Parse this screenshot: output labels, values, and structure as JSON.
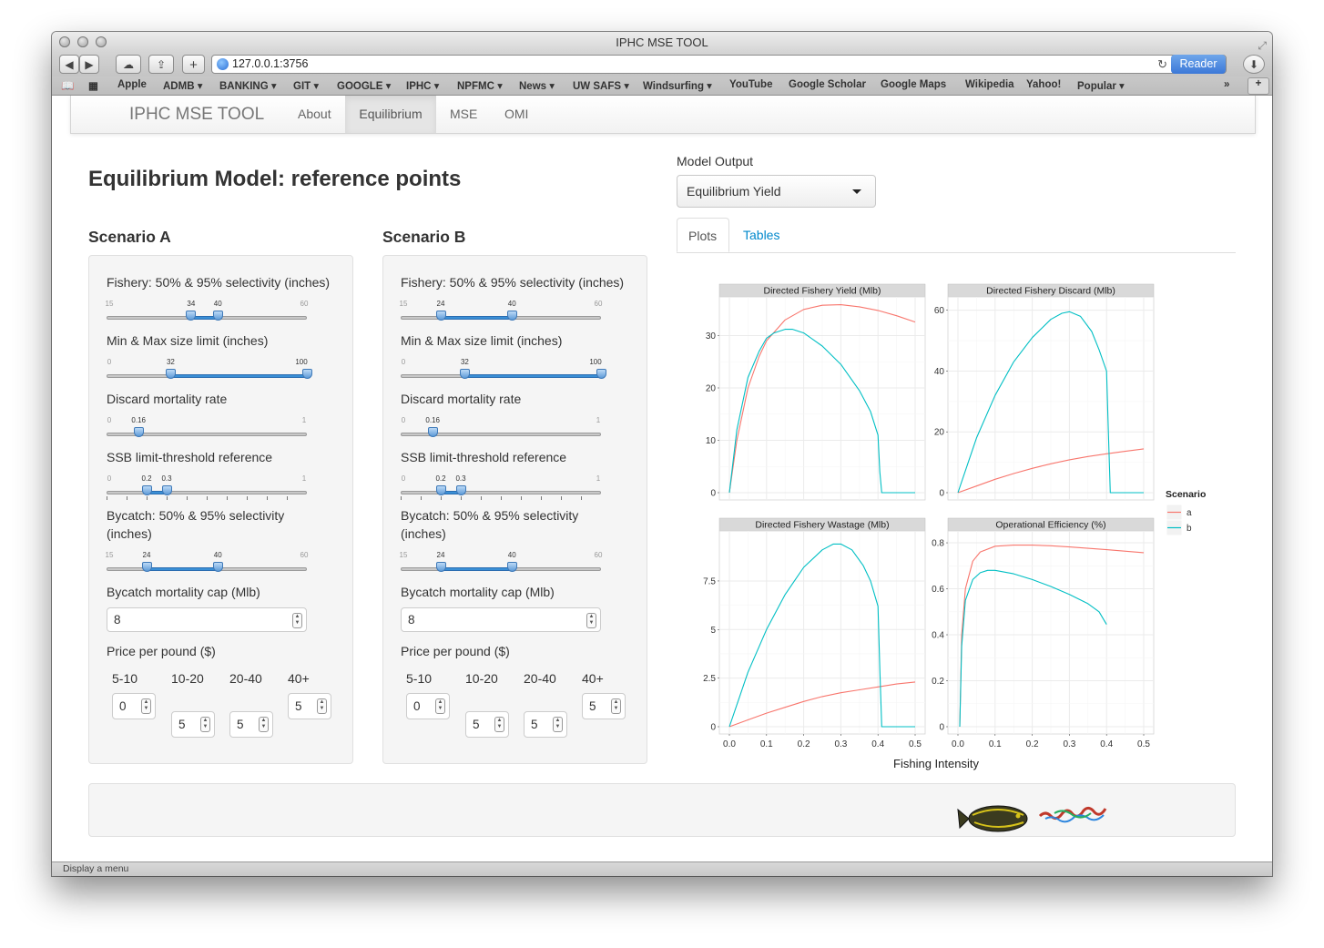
{
  "window": {
    "title": "IPHC MSE TOOL"
  },
  "browser": {
    "url": "127.0.0.1:3756",
    "reader_label": "Reader",
    "add_tab_label": "+",
    "bookmarks": [
      "Apple",
      "ADMB",
      "BANKING",
      "GIT",
      "GOOGLE",
      "IPHC",
      "NPFMC",
      "News",
      "UW SAFS",
      "Windsurfing",
      "YouTube",
      "Google Scholar",
      "Google Maps",
      "Wikipedia",
      "Yahoo!",
      "Popular"
    ],
    "bookmarks_with_menu": [
      "ADMB",
      "BANKING",
      "GIT",
      "GOOGLE",
      "IPHC",
      "NPFMC",
      "News",
      "UW SAFS",
      "Windsurfing",
      "Popular"
    ],
    "status_text": "Display a menu"
  },
  "navbar": {
    "brand": "IPHC MSE TOOL",
    "items": [
      {
        "label": "About",
        "active": false
      },
      {
        "label": "Equilibrium",
        "active": true
      },
      {
        "label": "MSE",
        "active": false
      },
      {
        "label": "OMI",
        "active": false
      }
    ]
  },
  "page_title": "Equilibrium Model: reference points",
  "scenarios": [
    {
      "title": "Scenario A",
      "fishery_selectivity": {
        "label": "Fishery: 50% & 95% selectivity (inches)",
        "min": 15,
        "max": 60,
        "values": [
          34,
          40
        ],
        "min_label": "15",
        "max_label": "60",
        "value_labels": [
          "34",
          "40"
        ]
      },
      "size_limit": {
        "label": "Min & Max size limit (inches)",
        "min": 0,
        "max": 100,
        "values": [
          32,
          100
        ],
        "min_label": "0",
        "value_labels": [
          "32",
          "100"
        ]
      },
      "discard_mortality": {
        "label": "Discard mortality rate",
        "min": 0,
        "max": 1,
        "value": 0.16,
        "min_label": "0",
        "max_label": "1",
        "value_label": "0.16"
      },
      "ssb_reference": {
        "label": "SSB limit-threshold reference",
        "min": 0,
        "max": 1,
        "values": [
          0.2,
          0.3
        ],
        "min_label": "0",
        "max_label": "1",
        "value_labels": [
          "0.2",
          "0.3"
        ]
      },
      "bycatch_selectivity": {
        "label": "Bycatch: 50% & 95% selectivity (inches)",
        "min": 15,
        "max": 60,
        "values": [
          24,
          40
        ],
        "min_label": "15",
        "max_label": "60",
        "value_labels": [
          "24",
          "40"
        ]
      },
      "bycatch_cap": {
        "label": "Bycatch mortality cap (Mlb)",
        "value": "8"
      },
      "price": {
        "label": "Price per pound ($)",
        "bins": [
          {
            "label": "5-10",
            "value": "0"
          },
          {
            "label": "10-20",
            "value": "5"
          },
          {
            "label": "20-40",
            "value": "5"
          },
          {
            "label": "40+",
            "value": "5"
          }
        ]
      }
    },
    {
      "title": "Scenario B",
      "fishery_selectivity": {
        "label": "Fishery: 50% & 95% selectivity (inches)",
        "min": 15,
        "max": 60,
        "values": [
          24,
          40
        ],
        "min_label": "15",
        "max_label": "60",
        "value_labels": [
          "24",
          "40"
        ]
      },
      "size_limit": {
        "label": "Min & Max size limit (inches)",
        "min": 0,
        "max": 100,
        "values": [
          32,
          100
        ],
        "min_label": "0",
        "value_labels": [
          "32",
          "100"
        ]
      },
      "discard_mortality": {
        "label": "Discard mortality rate",
        "min": 0,
        "max": 1,
        "value": 0.16,
        "min_label": "0",
        "max_label": "1",
        "value_label": "0.16"
      },
      "ssb_reference": {
        "label": "SSB limit-threshold reference",
        "min": 0,
        "max": 1,
        "values": [
          0.2,
          0.3
        ],
        "min_label": "0",
        "max_label": "1",
        "value_labels": [
          "0.2",
          "0.3"
        ]
      },
      "bycatch_selectivity": {
        "label": "Bycatch: 50% & 95% selectivity (inches)",
        "min": 15,
        "max": 60,
        "values": [
          24,
          40
        ],
        "min_label": "15",
        "max_label": "60",
        "value_labels": [
          "24",
          "40"
        ]
      },
      "bycatch_cap": {
        "label": "Bycatch mortality cap (Mlb)",
        "value": "8"
      },
      "price": {
        "label": "Price per pound ($)",
        "bins": [
          {
            "label": "5-10",
            "value": "0"
          },
          {
            "label": "10-20",
            "value": "5"
          },
          {
            "label": "20-40",
            "value": "5"
          },
          {
            "label": "40+",
            "value": "5"
          }
        ]
      }
    }
  ],
  "model_output": {
    "label": "Model Output",
    "selected": "Equilibrium Yield"
  },
  "output_tabs": [
    {
      "label": "Plots",
      "active": true
    },
    {
      "label": "Tables",
      "active": false
    }
  ],
  "colors": {
    "series_a": "#F8766D",
    "series_b": "#00BFC4",
    "accent": "#3a8fd6",
    "link": "#0088cc"
  },
  "chart_data": {
    "type": "line",
    "xlabel": "Fishing Intensity",
    "legend": {
      "title": "Scenario",
      "position": "right",
      "entries": [
        "a",
        "b"
      ]
    },
    "x_ticks": [
      "0.0",
      "0.1",
      "0.2",
      "0.3",
      "0.4",
      "0.5"
    ],
    "xlim": [
      0,
      0.5
    ],
    "grid": true,
    "panels": [
      {
        "title": "Directed Fishery Yield (Mlb)",
        "ylim": [
          0,
          36
        ],
        "y_ticks": [
          0,
          10,
          20,
          30
        ],
        "series": [
          {
            "name": "a",
            "x": [
              0,
              0.02,
              0.05,
              0.08,
              0.1,
              0.15,
              0.2,
              0.25,
              0.3,
              0.35,
              0.4,
              0.45,
              0.5
            ],
            "y": [
              0,
              10,
              20,
              26,
              29,
              33,
              35,
              35.8,
              35.9,
              35.5,
              34.8,
              33.8,
              32.6
            ]
          },
          {
            "name": "b",
            "x": [
              0,
              0.02,
              0.05,
              0.08,
              0.1,
              0.12,
              0.15,
              0.17,
              0.2,
              0.25,
              0.3,
              0.35,
              0.38,
              0.4,
              0.405,
              0.41,
              0.5
            ],
            "y": [
              0,
              12,
              22,
              27,
              29.5,
              30.5,
              31.2,
              31.2,
              30.5,
              28,
              24.5,
              19.5,
              15.5,
              11,
              4,
              0,
              0
            ]
          }
        ]
      },
      {
        "title": "Directed Fishery Discard (Mlb)",
        "ylim": [
          0,
          62
        ],
        "y_ticks": [
          0,
          20,
          40,
          60
        ],
        "series": [
          {
            "name": "a",
            "x": [
              0,
              0.05,
              0.1,
              0.15,
              0.2,
              0.25,
              0.3,
              0.35,
              0.4,
              0.45,
              0.5
            ],
            "y": [
              0,
              2.2,
              4.4,
              6.3,
              8,
              9.5,
              10.8,
              11.9,
              12.8,
              13.6,
              14.4
            ]
          },
          {
            "name": "b",
            "x": [
              0,
              0.05,
              0.1,
              0.15,
              0.2,
              0.25,
              0.28,
              0.3,
              0.33,
              0.36,
              0.38,
              0.4,
              0.405,
              0.41,
              0.5
            ],
            "y": [
              0,
              18,
              32,
              43,
              51,
              57,
              59,
              59.5,
              58,
              53,
              47,
              40,
              20,
              0,
              0
            ]
          }
        ]
      },
      {
        "title": "Directed Fishery Wastage (Mlb)",
        "ylim": [
          0,
          9.7
        ],
        "y_ticks": [
          0,
          2.5,
          5,
          7.5
        ],
        "series": [
          {
            "name": "a",
            "x": [
              0,
              0.05,
              0.1,
              0.15,
              0.2,
              0.25,
              0.3,
              0.35,
              0.4,
              0.45,
              0.5
            ],
            "y": [
              0,
              0.35,
              0.7,
              1,
              1.3,
              1.55,
              1.75,
              1.9,
              2.05,
              2.2,
              2.3
            ]
          },
          {
            "name": "b",
            "x": [
              0,
              0.05,
              0.1,
              0.15,
              0.2,
              0.25,
              0.28,
              0.3,
              0.33,
              0.36,
              0.38,
              0.4,
              0.405,
              0.41,
              0.5
            ],
            "y": [
              0,
              2.8,
              5,
              6.8,
              8.2,
              9.1,
              9.4,
              9.4,
              9.1,
              8.3,
              7.5,
              6.2,
              3,
              0,
              0
            ]
          }
        ]
      },
      {
        "title": "Operational Efficiency (%)",
        "ylim": [
          0,
          0.82
        ],
        "y_ticks": [
          0,
          0.2,
          0.4,
          0.6,
          0.8
        ],
        "series": [
          {
            "name": "a",
            "x": [
              0.005,
              0.01,
              0.02,
              0.04,
              0.06,
              0.1,
              0.15,
              0.2,
              0.25,
              0.3,
              0.4,
              0.5
            ],
            "y": [
              0,
              0.4,
              0.6,
              0.72,
              0.76,
              0.785,
              0.79,
              0.79,
              0.787,
              0.782,
              0.77,
              0.757
            ]
          },
          {
            "name": "b",
            "x": [
              0.005,
              0.01,
              0.02,
              0.04,
              0.06,
              0.08,
              0.1,
              0.15,
              0.2,
              0.25,
              0.3,
              0.35,
              0.38,
              0.4
            ],
            "y": [
              0,
              0.35,
              0.55,
              0.64,
              0.67,
              0.68,
              0.68,
              0.665,
              0.64,
              0.61,
              0.575,
              0.535,
              0.5,
              0.445
            ]
          }
        ]
      }
    ]
  }
}
